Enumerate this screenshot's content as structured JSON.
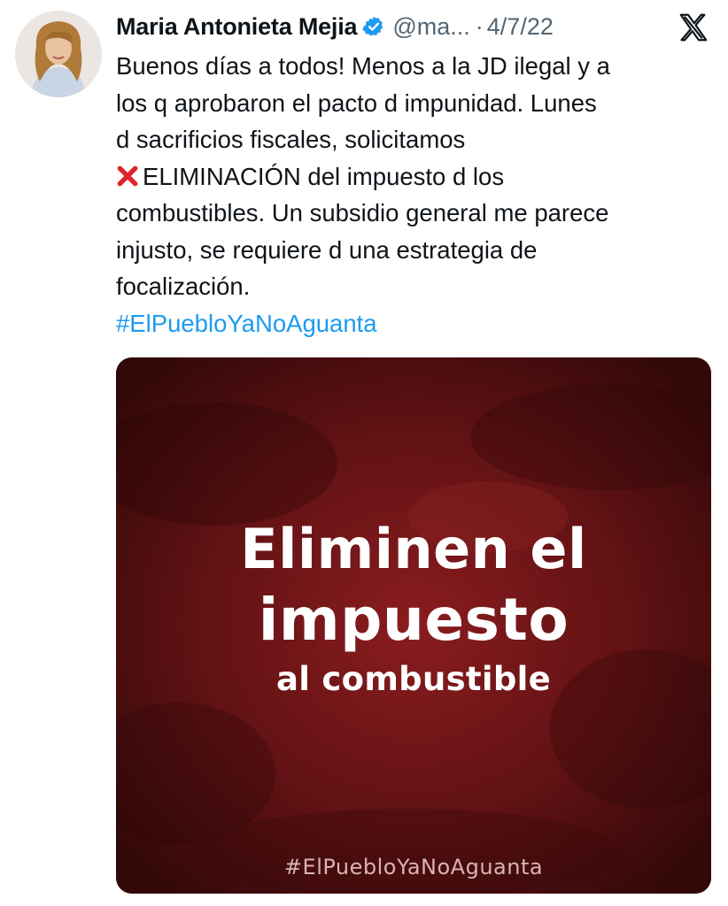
{
  "author": {
    "name": "Maria Antonieta Mejia",
    "handle": "@ma...",
    "separator": "·",
    "date": "4/7/22",
    "verified": true
  },
  "icons": {
    "avatar": "profile-photo",
    "verified": "verified-badge-icon",
    "platform": "x-logo-icon",
    "cross": "red-cross-mark-icon"
  },
  "tweet": {
    "line1": "Buenos días a todos! Menos a la JD ilegal y a",
    "line2": "los q aprobaron el pacto d impunidad. Lunes",
    "line3": "d sacrificios fiscales, solicitamos",
    "line4": "ELIMINACIÓN del impuesto d los",
    "line5": "combustibles. Un subsidio general me parece",
    "line6": "injusto, se requiere d una estrategia de",
    "line7": "focalización.",
    "hashtag": "#ElPuebloYaNoAguanta"
  },
  "media": {
    "headline_line1": "Eliminen el",
    "headline_line2": "impuesto",
    "headline_line3": "al combustible",
    "hashtag": "#ElPuebloYaNoAguanta"
  },
  "colors": {
    "text": "#0f1419",
    "secondary": "#536471",
    "link": "#1d9bf0",
    "verified": "#1d9bf0",
    "media_bg": "#5a0f10"
  }
}
